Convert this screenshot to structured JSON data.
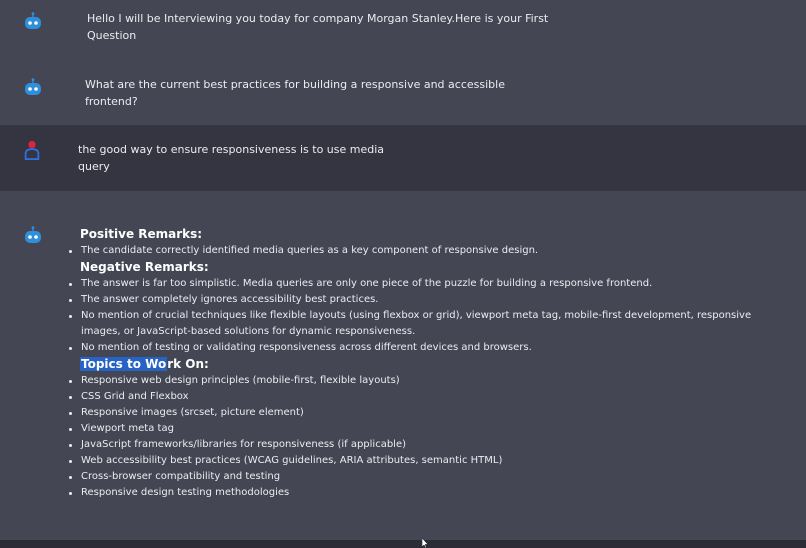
{
  "messages": [
    {
      "role": "bot",
      "text_line1": "Hello I will be Interviewing you today for company Morgan Stanley.Here is your First",
      "text_line2": "Question"
    },
    {
      "role": "bot",
      "text_line1": "What are the current best practices for building a responsive and accessible",
      "text_line2": "frontend?"
    },
    {
      "role": "user",
      "text_line1": "the good way to ensure responsiveness is to use media",
      "text_line2": "query"
    }
  ],
  "feedback": {
    "positive_heading": "Positive Remarks:",
    "positive": [
      "The candidate correctly identified media queries as a key component of responsive design."
    ],
    "negative_heading": "Negative Remarks:",
    "negative": [
      "The answer is far too simplistic. Media queries are only one piece of the puzzle for building a responsive frontend.",
      "The answer completely ignores accessibility best practices.",
      "No mention of crucial techniques like flexible layouts (using flexbox or grid), viewport meta tag, mobile-first development, responsive",
      "images, or JavaScript-based solutions for dynamic responsiveness.",
      "No mention of testing or validating responsiveness across different devices and browsers."
    ],
    "topics_heading_highlighted": "Topics to Wo",
    "topics_heading_rest": "rk On:",
    "topics": [
      "Responsive web design principles (mobile-first, flexible layouts)",
      "CSS Grid and Flexbox",
      "Responsive images (srcset, picture element)",
      "Viewport meta tag",
      "JavaScript frameworks/libraries for responsiveness (if applicable)",
      "Web accessibility best practices (WCAG guidelines, ARIA attributes, semantic HTML)",
      "Cross-browser compatibility and testing",
      "Responsive design testing methodologies"
    ]
  },
  "icons": {
    "bot": "robot-icon",
    "user": "user-icon",
    "cursor": "mouse-pointer-icon"
  },
  "colors": {
    "bot_bg": "#444654",
    "user_bg": "#343541",
    "bot_icon": "#2f8fdb",
    "user_icon_head": "#e2233b",
    "user_icon_body": "#2f6fdb",
    "highlight": "#2563c4"
  }
}
